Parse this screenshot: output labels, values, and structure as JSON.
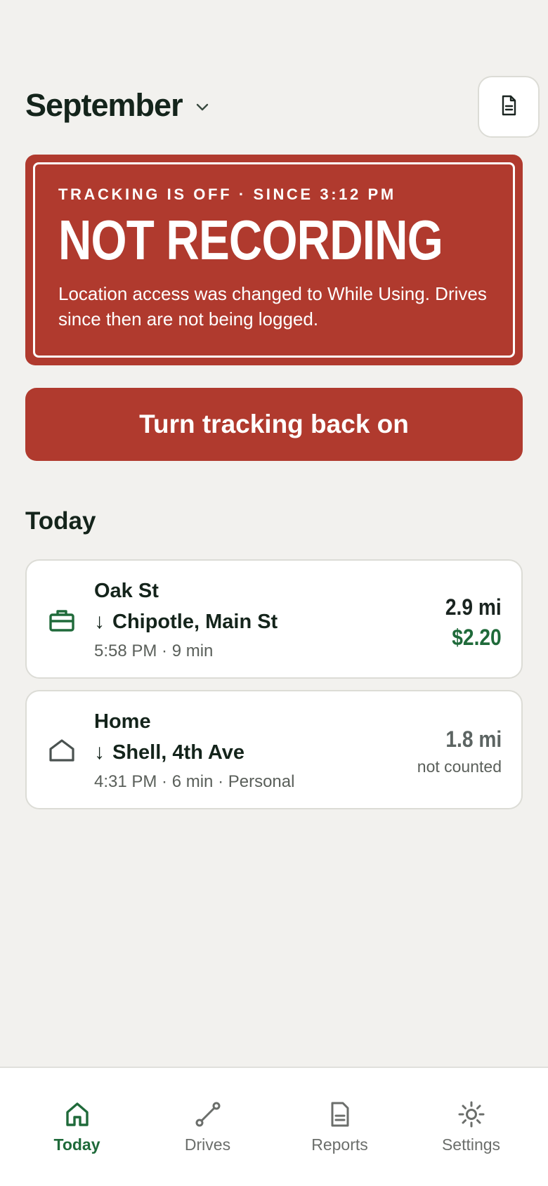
{
  "header": {
    "month": "September",
    "month_chevron_icon": "chevron-down-icon",
    "doc_icon": "document-icon"
  },
  "alert": {
    "eyebrow": "TRACKING IS OFF · SINCE 3:12 PM",
    "title": "NOT RECORDING",
    "body": "Location access was changed to While Using. Drives since then are not being logged.",
    "color": "#b03a2e"
  },
  "cta": {
    "label": "Turn tracking back on"
  },
  "today": {
    "title": "Today",
    "drives": [
      {
        "icon": "briefcase-icon",
        "from": "Oak St",
        "arrow": "↓",
        "to": "Chipotle, Main St",
        "meta": "5:58 PM · 9 min",
        "distance": "2.9 mi",
        "amount": "$2.20"
      },
      {
        "icon": "home-icon",
        "from": "Home",
        "arrow": "↓",
        "to": "Shell, 4th Ave",
        "meta": "4:31 PM · 6 min · Personal",
        "distance": "1.8 mi",
        "status": "not counted"
      }
    ]
  },
  "nav": {
    "items": [
      {
        "label": "Today",
        "icon": "home-icon",
        "active": true
      },
      {
        "label": "Drives",
        "icon": "route-icon",
        "active": false
      },
      {
        "label": "Reports",
        "icon": "document-icon",
        "active": false
      },
      {
        "label": "Settings",
        "icon": "gear-icon",
        "active": false
      }
    ]
  },
  "colors": {
    "accent_green": "#1f6a3a",
    "alert_red": "#b03a2e",
    "background": "#f2f1ee"
  }
}
